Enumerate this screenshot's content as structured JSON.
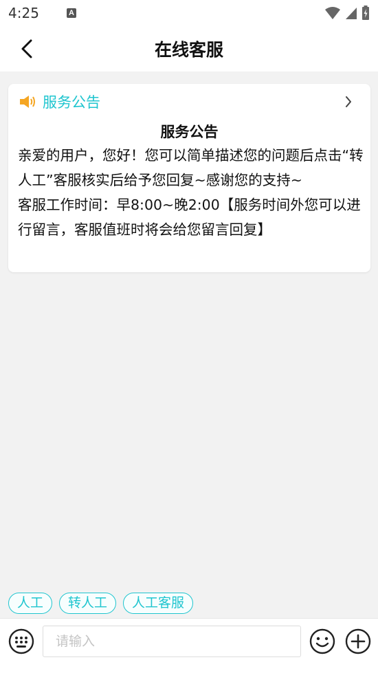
{
  "status_bar": {
    "time": "4:25",
    "notification_icon_letter": "A",
    "icons": [
      "wifi-icon",
      "signal-icon",
      "battery-icon"
    ]
  },
  "header": {
    "back_icon": "chevron-left-icon",
    "title": "在线客服"
  },
  "announcement": {
    "icon": "speaker-icon",
    "label": "服务公告",
    "chevron_icon": "chevron-right-icon",
    "title": "服务公告",
    "paragraphs": [
      "亲爱的用户，您好！您可以简单描述您的问题后点击“转人工”客服核实后给予您回复~感谢您的支持~",
      "客服工作时间：早8:00~晚2:00【服务时间外您可以进行留言，客服值班时将会给您留言回复】"
    ]
  },
  "quick_replies": [
    "人工",
    "转人工",
    "人工客服"
  ],
  "input_bar": {
    "keyboard_icon": "keyboard-icon",
    "placeholder": "请输入",
    "value": "",
    "emoji_icon": "emoji-icon",
    "plus_icon": "plus-icon"
  },
  "colors": {
    "accent": "#1fc5cf",
    "speaker": "#f5a623",
    "background": "#f2f2f2"
  }
}
